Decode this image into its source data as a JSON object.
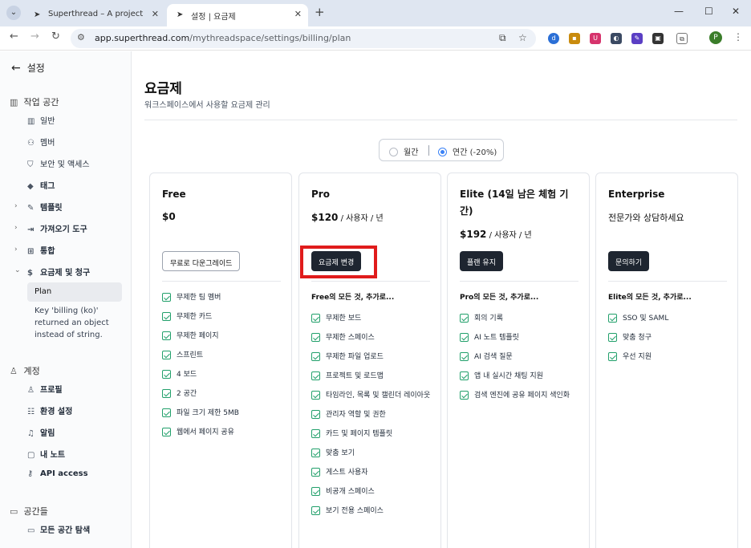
{
  "browser": {
    "tabs": [
      {
        "title": "Superthread – A project mana",
        "active": false
      },
      {
        "title": "설정 | 요금제",
        "active": true
      }
    ],
    "url_host": "app.superthread.com",
    "url_path": "/mythreadspace/settings/billing/plan",
    "profile_initial": "P"
  },
  "sidebar": {
    "back_label": "설정",
    "workspace_title": "작업 공간",
    "workspace_items": [
      {
        "label": "일반",
        "icon": "building-icon"
      },
      {
        "label": "멤버",
        "icon": "members-icon"
      },
      {
        "label": "보안 및 액세스",
        "icon": "shield-icon"
      },
      {
        "label": "태그",
        "icon": "tag-icon"
      },
      {
        "label": "템플릿",
        "icon": "template-icon"
      },
      {
        "label": "가져오기 도구",
        "icon": "import-icon"
      },
      {
        "label": "통합",
        "icon": "grid-icon"
      },
      {
        "label": "요금제 및 청구",
        "icon": "dollar-icon"
      }
    ],
    "plan_label": "Plan",
    "warning": "Key 'billing (ko)' returned an object instead of string.",
    "account_title": "계정",
    "account_items": [
      {
        "label": "프로필",
        "icon": "person-icon"
      },
      {
        "label": "환경 설정",
        "icon": "sliders-icon"
      },
      {
        "label": "알림",
        "icon": "bell-icon"
      },
      {
        "label": "내 노트",
        "icon": "note-icon"
      },
      {
        "label": "API access",
        "icon": "key-icon"
      }
    ],
    "spaces_title": "공간들",
    "spaces_items": [
      {
        "label": "모든 공간 탐색",
        "icon": "folder-icon"
      }
    ]
  },
  "main": {
    "title": "요금제",
    "subtitle": "워크스페이스에서 사용할 요금제 관리",
    "billing_toggle": {
      "monthly": "월간",
      "yearly": "연간 (-20%)",
      "selected": "yearly"
    },
    "plans": [
      {
        "name": "Free",
        "price": "$0",
        "unit": "",
        "button": "무료로 다운그레이드",
        "lead": "",
        "features": [
          "무제한 팀 멤버",
          "무제한 카드",
          "무제한 페이지",
          "스프린트",
          "4 보드",
          "2 공간",
          "파일 크기 제한 5MB",
          "웹에서 페이지 공유"
        ]
      },
      {
        "name": "Pro",
        "price": "$120",
        "unit": " / 사용자 / 년",
        "button": "요금제 변경",
        "lead": "Free의 모든 것, 추가로...",
        "features": [
          "무제한 보드",
          "무제한 스페이스",
          "무제한 파일 업로드",
          "프로젝트 및 로드맵",
          "타임라인, 목록 및 캘린더 레이아웃",
          "관리자 역할 및 권한",
          "카드 및 페이지 템플릿",
          "맞춤 보기",
          "게스트 사용자",
          "비공개 스페이스",
          "보기 전용 스페이스"
        ]
      },
      {
        "name": "Elite (14일 남은 체험 기간)",
        "price": "$192",
        "unit": " / 사용자 / 년",
        "button": "플랜 유지",
        "lead": "Pro의 모든 것, 추가로...",
        "features": [
          "회의 기록",
          "AI 노트 템플릿",
          "AI 검색 질문",
          "앱 내 실시간 채팅 지원",
          "검색 엔진에 공유 페이지 색인화"
        ]
      },
      {
        "name": "Enterprise",
        "price": "전문가와 상담하세요",
        "unit": "",
        "button": "문의하기",
        "lead": "Elite의 모든 것, 추가로...",
        "features": [
          "SSO 및 SAML",
          "맞춤 청구",
          "우선 지원"
        ]
      }
    ]
  },
  "colors": {
    "accent": "#3b82f6",
    "check": "#22a06b",
    "dark_button": "#1e2530",
    "highlight": "#e01b1b"
  }
}
